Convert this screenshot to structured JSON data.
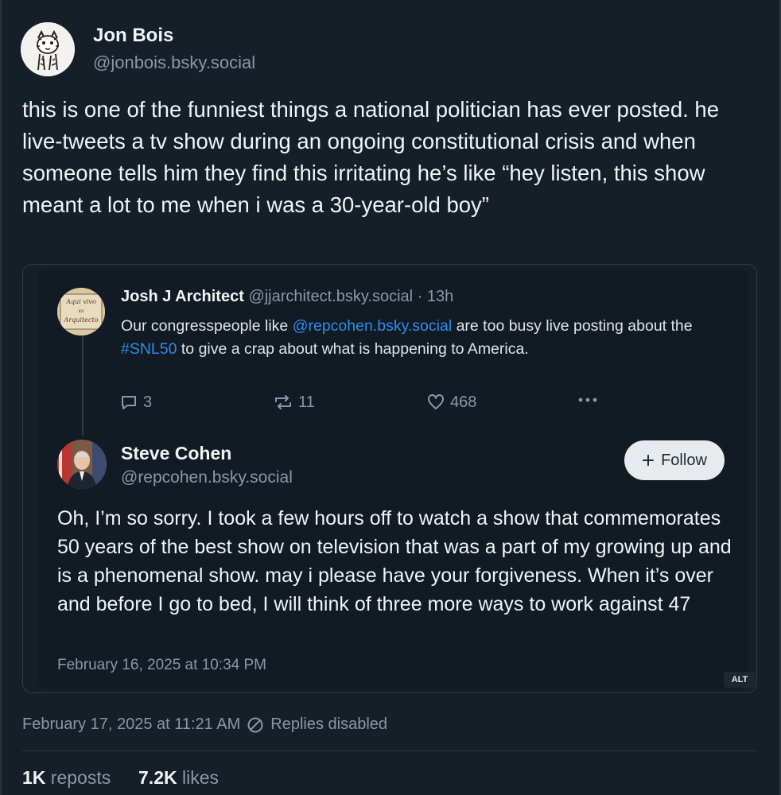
{
  "post": {
    "author_name": "Jon Bois",
    "author_handle": "@jonbois.bsky.social",
    "text": "this is one of the funniest things a national politician has ever posted. he live-tweets a tv show during an ongoing constitutional crisis and when someone tells him they find this irritating he’s like “hey listen, this show meant a lot to me when i was a 30-year-old boy”",
    "timestamp": "February 17, 2025 at 11:21 AM",
    "replies_status": "Replies disabled",
    "reposts_count": "1K",
    "reposts_label": "reposts",
    "likes_count": "7.2K",
    "likes_label": "likes"
  },
  "embed": {
    "parent": {
      "author_name": "Josh J Architect",
      "author_handle": "@jjarchitect.bsky.social",
      "age": "· 13h",
      "avatar_text_top": "Aqui vivo",
      "avatar_text_mid": "ıoı",
      "avatar_text_bottom": "Arquitecto",
      "text_part1": "Our congresspeople like ",
      "mention": "@repcohen.bsky.social",
      "text_part2": " are too busy live posting about the ",
      "hashtag": "#SNL50",
      "text_part3": " to give a crap about what is happening to America.",
      "replies": "3",
      "reposts": "11",
      "likes": "468"
    },
    "reply": {
      "author_name": "Steve Cohen",
      "author_handle": "@repcohen.bsky.social",
      "follow_label": "Follow",
      "text": "Oh, I’m so sorry. I took a few hours off to watch a show that commemorates 50 years of the best show on television that was a part of my growing up and is a phenomenal show. may i please have your forgiveness. When it’s over and before I go to bed, I will think of three more ways to work against 47",
      "timestamp": "February 16, 2025 at 10:34 PM"
    },
    "alt_badge": "ALT"
  },
  "colors": {
    "background": "#161e27",
    "muted_text": "#8a97a8",
    "link": "#2f8cf0",
    "follow_button_bg": "#e8ebee"
  }
}
